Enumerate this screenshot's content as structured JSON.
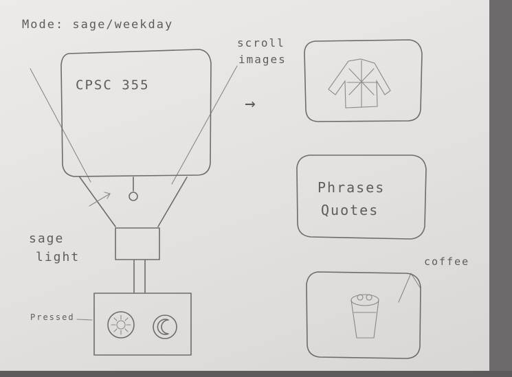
{
  "mode_label": "Mode: sage/weekday",
  "screen_text": "CPSC 355",
  "scroll_label": [
    "scroll",
    "images"
  ],
  "phrases_card": [
    "Phrases",
    "Quotes"
  ],
  "coffee_label": "coffee",
  "sage_light_label": [
    "sage",
    "light"
  ],
  "pressed_label": "Pressed",
  "arrow_glyph": "→",
  "icons": [
    "jacket-icon",
    "sun-button-icon",
    "moon-button-icon",
    "coffee-cup-icon",
    "light-bulb-icon"
  ],
  "colors": {
    "paper": "#e6e4e2",
    "pencil": "#6e6a6b",
    "background": "#6f6c6d"
  }
}
